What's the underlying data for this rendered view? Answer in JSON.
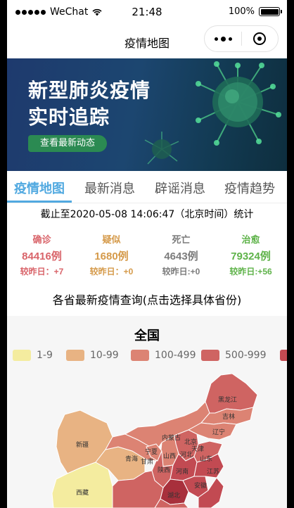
{
  "status_bar": {
    "carrier": "WeChat",
    "time": "21:48",
    "battery": "100%"
  },
  "nav": {
    "title": "疫情地图"
  },
  "banner": {
    "title_line1": "新型肺炎疫情",
    "title_line2": "实时追踪",
    "button_label": "查看最新动态"
  },
  "tabs": [
    {
      "label": "疫情地图",
      "active": true
    },
    {
      "label": "最新消息",
      "active": false
    },
    {
      "label": "辟谣消息",
      "active": false
    },
    {
      "label": "疫情趋势",
      "active": false
    }
  ],
  "update_time": "截止至2020-05-08 14:06:47（北京时间）统计",
  "stats": {
    "confirmed": {
      "label": "确诊",
      "count": "84416例",
      "delta": "较昨日：+7"
    },
    "suspected": {
      "label": "疑似",
      "count": "1680例",
      "delta": "较昨日：+0"
    },
    "dead": {
      "label": "死亡",
      "count": "4643例",
      "delta": "较昨日:+0"
    },
    "cured": {
      "label": "治愈",
      "count": "79324例",
      "delta": "较昨日:+56"
    }
  },
  "query_title": "各省最新疫情查询(点击选择具体省份)",
  "map": {
    "title": "全国",
    "legend": [
      {
        "label": "1-9",
        "color": "#f4ec9f"
      },
      {
        "label": "10-99",
        "color": "#e8b383"
      },
      {
        "label": "100-499",
        "color": "#dc8373"
      },
      {
        "label": "500-999",
        "color": "#cf6462"
      },
      {
        "label": "",
        "color": "#c24a52"
      }
    ],
    "provinces": [
      {
        "name": "新疆"
      },
      {
        "name": "黑龙江"
      },
      {
        "name": "吉林"
      },
      {
        "name": "辽宁"
      },
      {
        "name": "内蒙古"
      },
      {
        "name": "北京"
      },
      {
        "name": "天津"
      },
      {
        "name": "河北"
      },
      {
        "name": "山西"
      },
      {
        "name": "宁夏"
      },
      {
        "name": "青海"
      },
      {
        "name": "甘肃"
      },
      {
        "name": "山东"
      },
      {
        "name": "陕西"
      },
      {
        "name": "河南"
      },
      {
        "name": "江苏"
      },
      {
        "name": "安徽"
      },
      {
        "name": "湖北"
      },
      {
        "name": "西藏"
      }
    ]
  }
}
